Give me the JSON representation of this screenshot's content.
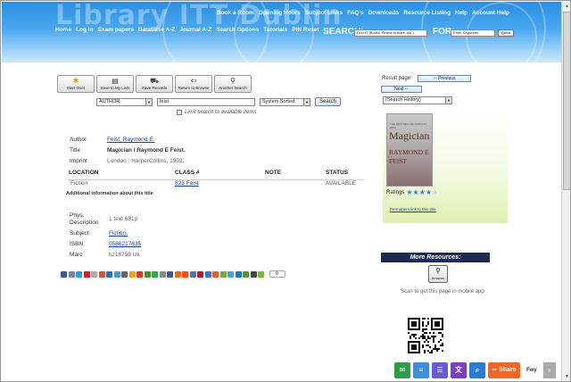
{
  "header": {
    "brand": "Library ITT Dublin",
    "top_nav": [
      "Book a Room",
      "Opening Hours",
      "Subject Links",
      "FAQ's",
      "Downloads",
      "Resource Listing",
      "Help",
      "Account Help"
    ],
    "sec_nav": [
      "Home",
      "Log in",
      "Exam papers",
      "Database A-Z",
      "Journal A-Z",
      "Search Options",
      "Tutorials",
      "PIN Reset"
    ],
    "search_label": "SEARCH:",
    "search_scope": "Find IT (Books, Online Articles, etc.)",
    "for_label": "FOR:",
    "for_placeholder": "Enter Keywords",
    "go_label": "Quick"
  },
  "toolbar": {
    "buttons": [
      {
        "label": "Start Over",
        "icon": "start-over-icon"
      },
      {
        "label": "Save to My Lists",
        "icon": "save-list-icon"
      },
      {
        "label": "Save Records",
        "icon": "cart-icon"
      },
      {
        "label": "Return to Browse",
        "icon": "return-icon"
      },
      {
        "label": "Another Search",
        "icon": "magnifier-icon"
      }
    ]
  },
  "search": {
    "field": "AUTHOR",
    "query": "feist",
    "sort": "System Sorted",
    "submit_label": "Search",
    "limit_label": "Limit search to available items"
  },
  "record": {
    "author_label": "Author",
    "author": "Feist, Raymond E.",
    "title_label": "Title",
    "title": "Magician / Raymond E Feist.",
    "imprint_label": "Imprint",
    "imprint": "London : HarperCollins, 1992."
  },
  "holdings": {
    "headers": [
      "LOCATION",
      "CLASS #",
      "NOTE",
      "STATUS"
    ],
    "rows": [
      [
        "Fiction",
        "823 Feist",
        "",
        "AVAILABLE"
      ]
    ]
  },
  "additional_info": "Additional information about this title",
  "extra": {
    "phys_label_1": "Phys.",
    "phys_label_2": "Description",
    "phys": "1 text 681p",
    "subject_label": "Subject",
    "subject": "Fiction.",
    "isbn_label": "ISBN",
    "isbn": "0586217835",
    "marc_label": "Marc",
    "marc": "hz18758 Uk"
  },
  "share_count": "0",
  "share_icon_colors": [
    "#3b5998",
    "#6d84b4",
    "#1da1f2",
    "#cb2027",
    "#aaaaaa",
    "#d9532c",
    "#2a6ebb",
    "#4b9bd1",
    "#666666",
    "#f4a300",
    "#e32",
    "#4f8b2c",
    "#2fa84f",
    "#888888",
    "#3b5998",
    "#e66a22",
    "#fc4b1b",
    "#5574a6",
    "#c8102e",
    "#3a7bbf",
    "#ea5a2a",
    "#7caa2d",
    "#4aa1d7",
    "#1d77b6",
    "#5d8e2f",
    "#444444",
    "#77b82a"
  ],
  "sidebar": {
    "result_page_label": "Result page:",
    "previous_label": "Previous",
    "next_label": "Next",
    "history_select": "(Search History)",
    "cover_subtitle": "THE BESTSELLING FANTASY EPIC",
    "cover_title": "Magician",
    "cover_author_1": "RAYMOND E",
    "cover_author_2": "FEIST",
    "ratings_label": "Ratings",
    "rating": 4,
    "rating_max": 5,
    "permalink_label": "Permanent link to this title",
    "more_resources": "More Resources:",
    "amazon_label": "Amazon",
    "scan_text": "Scan to get this page in mobile app"
  },
  "sharebar": {
    "icons": [
      {
        "name": "email-share-icon",
        "color": "#2e9d4a",
        "glyph": "✉"
      },
      {
        "name": "notes-share-icon",
        "color": "#3d8ee0",
        "glyph": "≡"
      },
      {
        "name": "list-share-icon",
        "color": "#6a5ad6",
        "glyph": "☰"
      },
      {
        "name": "translate-share-icon",
        "color": "#7b3fc4",
        "glyph": "文"
      },
      {
        "name": "search-share-icon",
        "color": "#2b7ad6",
        "glyph": "⌕"
      }
    ],
    "share_label": "Share",
    "brand": "Fwy",
    "collapse": "›"
  }
}
